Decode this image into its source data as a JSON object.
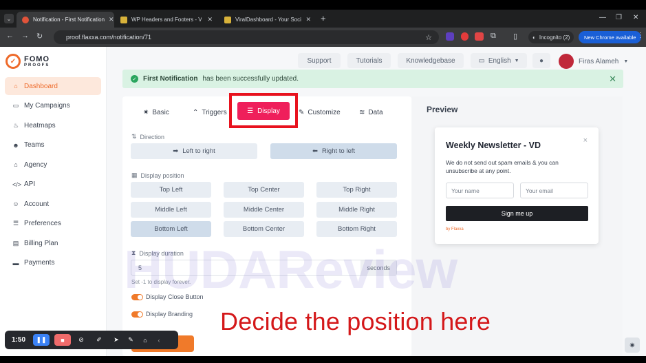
{
  "browser": {
    "tabs": [
      {
        "title": "Notification - First Notification",
        "active": true,
        "favicon_color": "#e0533a"
      },
      {
        "title": "WP Headers and Footers - Viral",
        "active": false,
        "favicon_color": "#d8b23a"
      },
      {
        "title": "ViralDashboard - Your Social M",
        "active": false,
        "favicon_color": "#d8b23a"
      }
    ],
    "new_tab": "+",
    "url": "proof.flaxxa.com/notification/71",
    "incognito_label": "Incognito (2)",
    "new_chrome_label": "New Chrome available"
  },
  "app": {
    "logo_top": "FOMO",
    "logo_bottom": "PROOFS",
    "brand_color": "#ee6a2a",
    "sidebar": [
      {
        "label": "Dashboard",
        "icon": "home-icon",
        "glyph": "⌂",
        "active": true
      },
      {
        "label": "My Campaigns",
        "icon": "monitor-icon",
        "glyph": "▭",
        "active": false
      },
      {
        "label": "Heatmaps",
        "icon": "flame-icon",
        "glyph": "♨",
        "active": false
      },
      {
        "label": "Teams",
        "icon": "users-icon",
        "glyph": "☻",
        "active": false
      },
      {
        "label": "Agency",
        "icon": "bank-icon",
        "glyph": "⌂",
        "active": false
      },
      {
        "label": "API",
        "icon": "code-icon",
        "glyph": "</>",
        "active": false
      },
      {
        "label": "Account",
        "icon": "user-cog-icon",
        "glyph": "☺",
        "active": false
      },
      {
        "label": "Preferences",
        "icon": "sliders-icon",
        "glyph": "☰",
        "active": false
      },
      {
        "label": "Billing Plan",
        "icon": "receipt-icon",
        "glyph": "▤",
        "active": false
      },
      {
        "label": "Payments",
        "icon": "card-icon",
        "glyph": "▬",
        "active": false
      }
    ],
    "header": {
      "support": "Support",
      "tutorials": "Tutorials",
      "knowledgebase": "Knowledgebase",
      "language": "English",
      "user_name": "Firas Alameh"
    },
    "notice": {
      "bold": "First Notification",
      "text": "has been successfully updated."
    },
    "tabs": {
      "basic": "Basic",
      "triggers": "Triggers",
      "display": "Display",
      "customize": "Customize",
      "data": "Data"
    },
    "direction": {
      "label": "Direction",
      "ltr": "Left to right",
      "rtl": "Right to left"
    },
    "position": {
      "label": "Display position",
      "options": [
        "Top Left",
        "Top Center",
        "Top Right",
        "Middle Left",
        "Middle Center",
        "Middle Right",
        "Bottom Left",
        "Bottom Center",
        "Bottom Right"
      ],
      "selected": "Bottom Left"
    },
    "duration": {
      "label": "Display duration",
      "value": "5",
      "unit": "seconds",
      "hint": "Set -1 to display forever."
    },
    "close_button": "Display Close Button",
    "branding": "Display Branding",
    "preview": {
      "title": "Preview",
      "widget_title": "Weekly Newsletter - VD",
      "widget_text": "We do not send out spam emails & you can unsubscribe at any point.",
      "name_placeholder": "Your name",
      "email_placeholder": "Your email",
      "submit": "Sign me up",
      "branding": "by Flaxxa",
      "close": "×"
    }
  },
  "overlay": {
    "caption": "Decide the position here",
    "watermark": "HUDAReview",
    "recorder_time": "1:50"
  }
}
